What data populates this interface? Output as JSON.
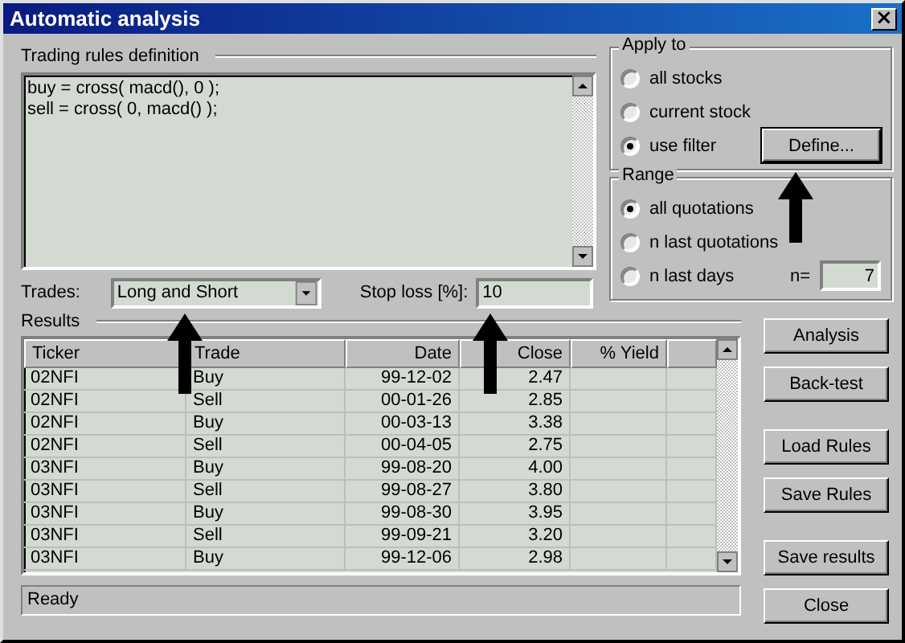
{
  "window": {
    "title": "Automatic analysis",
    "close_glyph": "×"
  },
  "rules": {
    "label": "Trading rules definition",
    "lines": [
      "buy = cross( macd(), 0 );",
      "sell = cross( 0, macd() );"
    ]
  },
  "trades": {
    "label": "Trades:",
    "value": "Long and Short"
  },
  "stop_loss": {
    "label": "Stop loss [%]:",
    "value": "10"
  },
  "apply_to": {
    "label": "Apply to",
    "options": [
      {
        "label": "all stocks",
        "selected": false
      },
      {
        "label": "current stock",
        "selected": false
      },
      {
        "label": "use filter",
        "selected": true
      }
    ],
    "define_button": "Define..."
  },
  "range": {
    "label": "Range",
    "options": [
      {
        "label": "all quotations",
        "selected": true
      },
      {
        "label": "n last quotations",
        "selected": false
      },
      {
        "label": "n last days",
        "selected": false
      }
    ],
    "n_label": "n=",
    "n_value": "7"
  },
  "results": {
    "label": "Results",
    "columns": [
      "Ticker",
      "Trade",
      "Date",
      "Close",
      "% Yield"
    ],
    "rows": [
      [
        "02NFI",
        "Buy",
        "99-12-02",
        "2.47",
        ""
      ],
      [
        "02NFI",
        "Sell",
        "00-01-26",
        "2.85",
        ""
      ],
      [
        "02NFI",
        "Buy",
        "00-03-13",
        "3.38",
        ""
      ],
      [
        "02NFI",
        "Sell",
        "00-04-05",
        "2.75",
        ""
      ],
      [
        "03NFI",
        "Buy",
        "99-08-20",
        "4.00",
        ""
      ],
      [
        "03NFI",
        "Sell",
        "99-08-27",
        "3.80",
        ""
      ],
      [
        "03NFI",
        "Buy",
        "99-08-30",
        "3.95",
        ""
      ],
      [
        "03NFI",
        "Sell",
        "99-09-21",
        "3.20",
        ""
      ],
      [
        "03NFI",
        "Buy",
        "99-12-06",
        "2.98",
        ""
      ]
    ]
  },
  "button_groups": [
    [
      "Analysis",
      "Back-test"
    ],
    [
      "Load Rules",
      "Save Rules"
    ],
    [
      "Save results",
      "Close"
    ]
  ],
  "status_bar": "Ready"
}
